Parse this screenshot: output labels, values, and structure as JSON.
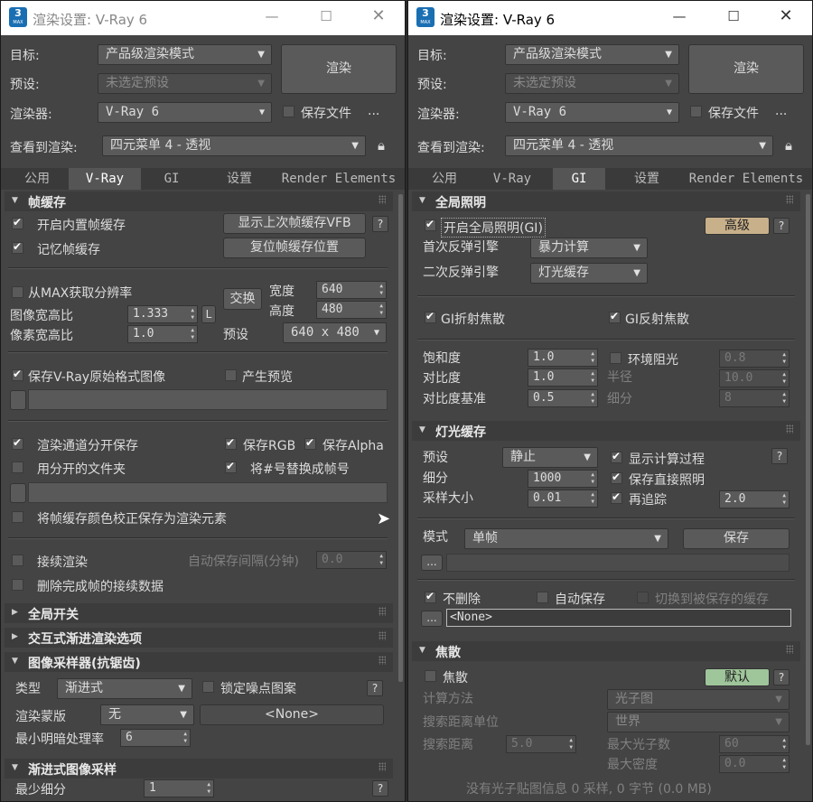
{
  "left": {
    "title": "渲染设置: V-Ray 6",
    "header": {
      "target_label": "目标:",
      "target_value": "产品级渲染模式",
      "preset_label": "预设:",
      "preset_value": "未选定预设",
      "renderer_label": "渲染器:",
      "renderer_value": "V-Ray 6",
      "save_file": "保存文件",
      "more": "...",
      "view_label": "查看到渲染:",
      "view_value": "四元菜单 4 - 透视",
      "render_btn": "渲染"
    },
    "tabs": [
      "公用",
      "V-Ray",
      "GI",
      "设置",
      "Render Elements"
    ],
    "fb": {
      "title": "帧缓存",
      "enable_vfb": "开启内置帧缓存",
      "show_last": "显示上次帧缓存VFB",
      "memory_fb": "记忆帧缓存",
      "reset_pos": "复位帧缓存位置",
      "from_max": "从MAX获取分辨率",
      "swap": "交换",
      "width_label": "宽度",
      "width_value": "640",
      "height_label": "高度",
      "height_value": "480",
      "aspect_label": "图像宽高比",
      "aspect_value": "1.333",
      "l_btn": "L",
      "pixel_label": "像素宽高比",
      "pixel_value": "1.0",
      "preset_label": "预设",
      "preset_value": "640 x 480",
      "save_raw": "保存V-Ray原始格式图像",
      "gen_preview": "产生预览",
      "separate": "渲染通道分开保存",
      "save_rgb": "保存RGB",
      "save_alpha": "保存Alpha",
      "separate_folder": "用分开的文件夹",
      "replace_hash": "将#号替换成帧号",
      "save_cc": "将帧缓存颜色校正保存为渲染元素",
      "resume": "接续渲染",
      "autosave_label": "自动保存间隔(分钟)",
      "autosave_value": "0.0",
      "delete_resume": "删除完成帧的接续数据"
    },
    "global_switch": "全局开关",
    "ipr": "交互式渐进渲染选项",
    "aa": {
      "title": "图像采样器(抗锯齿)",
      "type_label": "类型",
      "type_value": "渐进式",
      "lock_noise": "锁定噪点图案",
      "mask_label": "渲染蒙版",
      "mask_value": "无",
      "mask_none": "<None>",
      "min_shading_label": "最小明暗处理率",
      "min_shading_value": "6"
    },
    "prog": {
      "title": "渐进式图像采样",
      "min_sub_label": "最少细分",
      "min_sub_value": "1"
    }
  },
  "right": {
    "title": "渲染设置: V-Ray 6",
    "header": {
      "target_label": "目标:",
      "target_value": "产品级渲染模式",
      "preset_label": "预设:",
      "preset_value": "未选定预设",
      "renderer_label": "渲染器:",
      "renderer_value": "V-Ray 6",
      "save_file": "保存文件",
      "more": "...",
      "view_label": "查看到渲染:",
      "view_value": "四元菜单 4 - 透视",
      "render_btn": "渲染"
    },
    "tabs": [
      "公用",
      "V-Ray",
      "GI",
      "设置",
      "Render Elements"
    ],
    "gi": {
      "title": "全局照明",
      "enable_gi": "开启全局照明(GI)",
      "advanced": "高级",
      "primary_label": "首次反弹引擎",
      "primary_value": "暴力计算",
      "secondary_label": "二次反弹引擎",
      "secondary_value": "灯光缓存",
      "refract": "GI折射焦散",
      "reflect": "GI反射焦散",
      "saturation_label": "饱和度",
      "saturation_value": "1.0",
      "ao": "环境阻光",
      "ao_value": "0.8",
      "contrast_label": "对比度",
      "contrast_value": "1.0",
      "radius_label": "半径",
      "radius_value": "10.0",
      "contrast_base_label": "对比度基准",
      "contrast_base_value": "0.5",
      "subdiv_label": "细分",
      "subdiv_value": "8"
    },
    "lc": {
      "title": "灯光缓存",
      "preset_label": "预设",
      "preset_value": "静止",
      "show_calc": "显示计算过程",
      "subdivs_label": "细分",
      "subdivs_value": "1000",
      "store_direct": "保存直接照明",
      "sample_size_label": "采样大小",
      "sample_size_value": "0.01",
      "retrace": "再追踪",
      "retrace_value": "2.0",
      "mode_label": "模式",
      "mode_value": "单帧",
      "save_btn": "保存",
      "browse": "...",
      "dont_delete": "不删除",
      "auto_save": "自动保存",
      "switch_saved": "切换到被保存的缓存",
      "none": "<None>"
    },
    "caustics": {
      "title": "焦散",
      "enable": "焦散",
      "default_btn": "默认",
      "method_label": "计算方法",
      "method_value": "光子图",
      "unit_label": "搜索距离单位",
      "unit_value": "世界",
      "dist_label": "搜索距离",
      "dist_value": "5.0",
      "max_photons_label": "最大光子数",
      "max_photons_value": "60",
      "max_density_label": "最大密度",
      "max_density_value": "0.0",
      "info": "没有光子贴图信息 0 采样, 0 字节 (0.0 MB)"
    }
  },
  "colors": {
    "advanced_btn": "#c8b08a",
    "default_btn": "#9fc59a",
    "accent_icon": "#1a6fb3"
  }
}
